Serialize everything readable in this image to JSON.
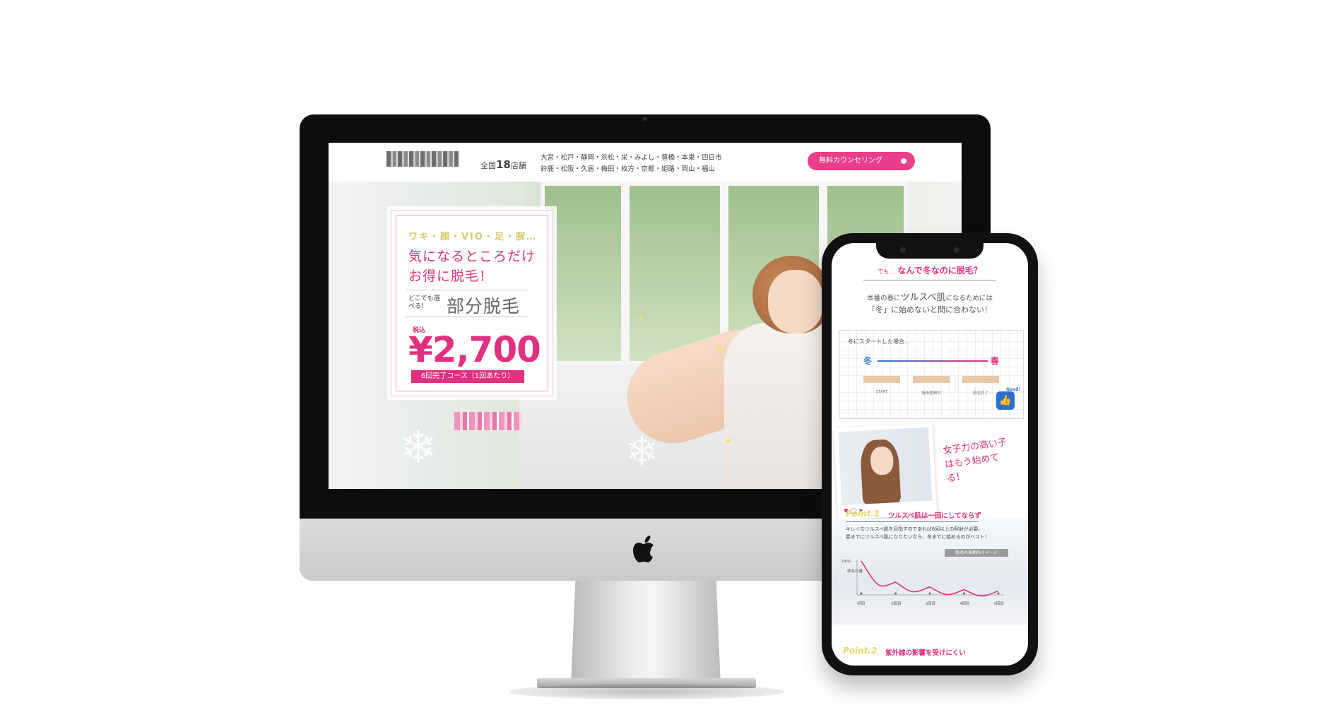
{
  "desktop": {
    "header": {
      "store_count_prefix": "全国",
      "store_count_number": "18",
      "store_count_suffix": "店舗",
      "store_list_line1": "大宮・松戸・静岡・浜松・栄・みよし・豊橋・本巣・四日市",
      "store_list_line2": "鈴鹿・松阪・久居・梅田・枚方・京都・姫路・岡山・福山",
      "cta_label": "無料カウンセリング"
    },
    "promo": {
      "parts": "ワキ・顔・VIO・足・腕…",
      "headline_line1": "気になるところだけ",
      "headline_line2": "お得に脱毛！",
      "anywhere": "どこでも選べる！",
      "title": "部分脱毛",
      "tax_label": "税込",
      "price": "¥2,700",
      "course": "6回完了コース（1回あたり）"
    }
  },
  "mobile": {
    "heading_small": "でも…",
    "heading": "なんで冬なのに脱毛？",
    "sub1_a": "本番の春に",
    "sub1_b": "ツルスベ肌",
    "sub1_c": "になるためには",
    "sub2": "「冬」に始めないと間に合わない！",
    "chart_title": "冬にスタートした場合…",
    "winter": "冬",
    "spring": "春",
    "stages": [
      "START",
      "施術期間中",
      "脱毛終了"
    ],
    "good": "Good!",
    "handwritten": "女子力の高い子はもう始めてる！",
    "point1_label": "Point.1",
    "point1_title": "ツルスベ肌は一回にしてならず",
    "point1_text_line1": "キレイなツルスベ肌を目指すのであれば6回以上の照射が必要。",
    "point1_text_line2": "春までにツルスベ肌になりたいなら、冬までに始めるのがベスト！",
    "graph_badge": "脱毛の長期的イメージ",
    "graph_y_top": "100%",
    "graph_y_label": "体毛の量",
    "graph_x_labels": [
      "初回",
      "2回目",
      "3回目",
      "4回目",
      "5回目"
    ],
    "graph_values": [
      100,
      35,
      20,
      12,
      8
    ],
    "point2_label": "Point.2",
    "point2_title": "紫外線の影響を受けにくい"
  },
  "colors": {
    "accent": "#e0307f",
    "cta": "#e83f8a",
    "gold": "#d7c96b",
    "blue": "#2b7fd1"
  }
}
